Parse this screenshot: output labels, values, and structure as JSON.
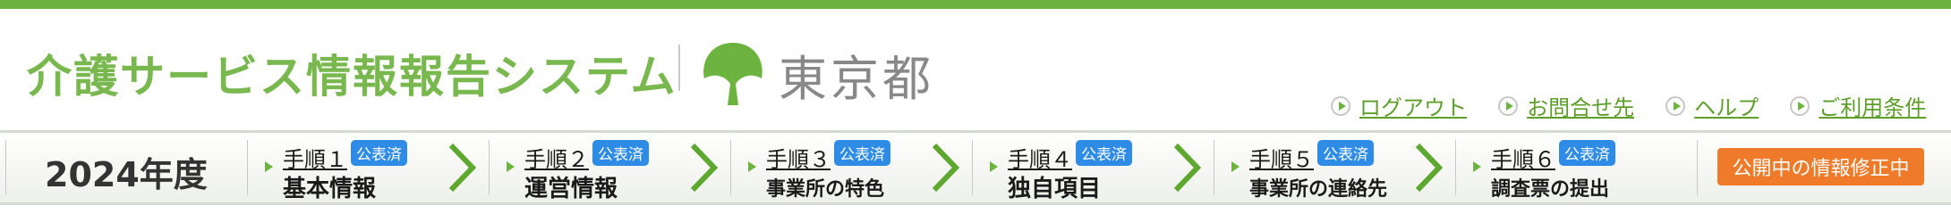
{
  "header": {
    "system_title": "介護サービス情報報告システム",
    "municipality": "東京都",
    "brand_color": "#6db33f",
    "logo_icon": "tokyo-ginkgo-logo-icon"
  },
  "util_links": [
    {
      "label": "ログアウト",
      "icon": "circle-arrow-icon"
    },
    {
      "label": "お問合せ先",
      "icon": "circle-arrow-icon"
    },
    {
      "label": "ヘルプ",
      "icon": "circle-arrow-icon"
    },
    {
      "label": "ご利用条件",
      "icon": "circle-arrow-icon"
    }
  ],
  "nav": {
    "fiscal_year": "2024年度",
    "steps": [
      {
        "step": "手順１",
        "label": "基本情報",
        "badge": "公表済"
      },
      {
        "step": "手順２",
        "label": "運営情報",
        "badge": "公表済"
      },
      {
        "step": "手順３",
        "label": "事業所の特色",
        "badge": "公表済"
      },
      {
        "step": "手順４",
        "label": "独自項目",
        "badge": "公表済"
      },
      {
        "step": "手順５",
        "label": "事業所の連絡先",
        "badge": "公表済"
      },
      {
        "step": "手順６",
        "label": "調査票の提出",
        "badge": "公表済"
      }
    ],
    "action_button": "公開中の情報修正中",
    "badge_color": "#2e8be6",
    "action_color": "#ee7a2a"
  }
}
